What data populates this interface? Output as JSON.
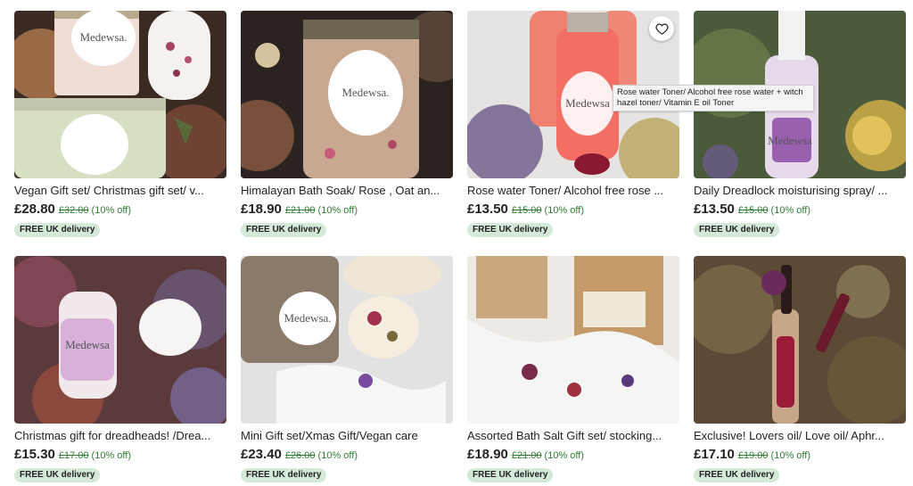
{
  "listings": [
    {
      "title": "Vegan Gift set/ Christmas gift set/ v...",
      "price": "£28.80",
      "original": "£32.00",
      "discount": "(10% off)",
      "badge": "FREE UK delivery",
      "label": "Medewsa."
    },
    {
      "title": "Himalayan Bath Soak/ Rose , Oat an...",
      "price": "£18.90",
      "original": "£21.00",
      "discount": "(10% off)",
      "badge": "FREE UK delivery",
      "label": "Medewsa."
    },
    {
      "title": "Rose water Toner/ Alcohol free rose ...",
      "price": "£13.50",
      "original": "£15.00",
      "discount": "(10% off)",
      "badge": "FREE UK delivery",
      "label": "Medewsa"
    },
    {
      "title": "Daily Dreadlock moisturising spray/ ...",
      "price": "£13.50",
      "original": "£15.00",
      "discount": "(10% off)",
      "badge": "FREE UK delivery",
      "label": "Medewsa"
    },
    {
      "title": "Christmas gift for dreadheads! /Drea...",
      "price": "£15.30",
      "original": "£17.00",
      "discount": "(10% off)",
      "badge": "FREE UK delivery",
      "label": "Medewsa"
    },
    {
      "title": "Mini Gift set/Xmas Gift/Vegan care",
      "price": "£23.40",
      "original": "£26.00",
      "discount": "(10% off)",
      "badge": "FREE UK delivery",
      "label": "Medewsa."
    },
    {
      "title": "Assorted Bath Salt Gift set/ stocking...",
      "price": "£18.90",
      "original": "£21.00",
      "discount": "(10% off)",
      "badge": "FREE UK delivery",
      "label": ""
    },
    {
      "title": "Exclusive! Lovers oil/ Love oil/ Aphr...",
      "price": "£17.10",
      "original": "£19.00",
      "discount": "(10% off)",
      "badge": "FREE UK delivery",
      "label": ""
    }
  ],
  "tooltip": "Rose water Toner/ Alcohol free rose water + witch hazel toner/ Vitamin E oil Toner",
  "favorite_icon": "heart-outline-icon",
  "colors": {
    "discount_green": "#2e7d32",
    "badge_bg": "#d4e9d7"
  }
}
